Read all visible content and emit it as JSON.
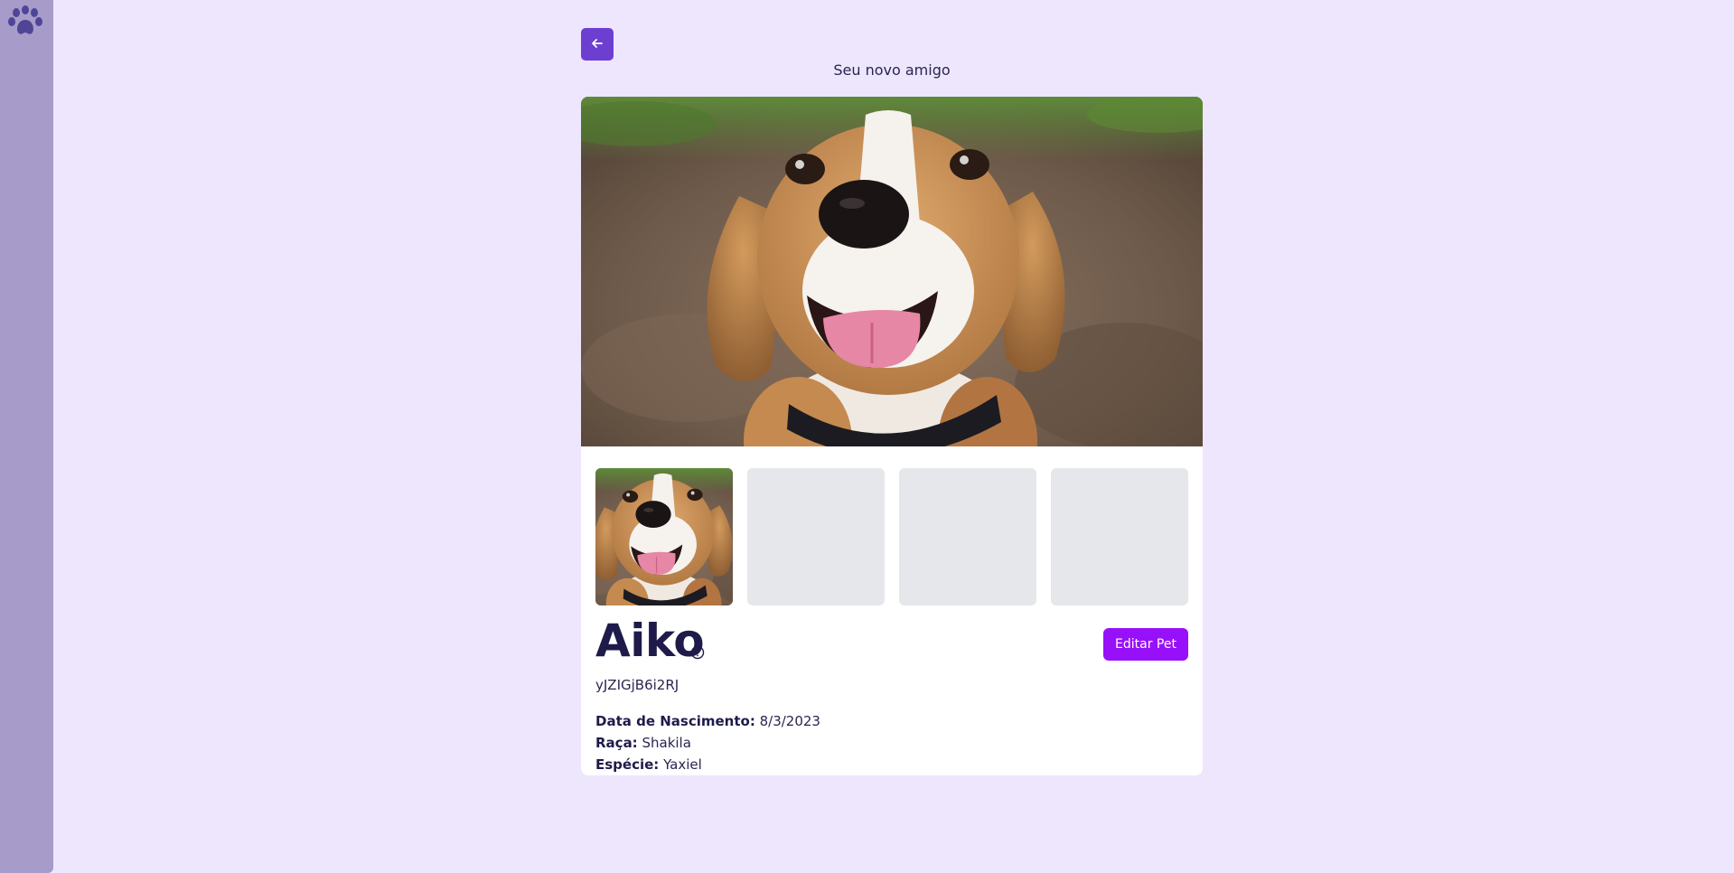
{
  "sidebar": {
    "logo_icon": "paw-icon"
  },
  "header": {
    "back_icon": "arrow-left-icon",
    "subtitle": "Seu novo amigo"
  },
  "gallery": {
    "main_image": "beagle-photo",
    "thumbnails": [
      {
        "kind": "beagle-photo",
        "selected": true
      },
      {
        "kind": "placeholder"
      },
      {
        "kind": "placeholder"
      },
      {
        "kind": "placeholder"
      }
    ]
  },
  "pet": {
    "name": "Aiko",
    "help_icon": "question-circle-icon",
    "code": "yJZIGjB6i2RJ",
    "edit_label": "Editar Pet",
    "details": [
      {
        "label": "Data de Nascimento:",
        "value": "8/3/2023"
      },
      {
        "label": "Raça:",
        "value": "Shakila"
      },
      {
        "label": "Espécie:",
        "value": "Yaxiel"
      }
    ]
  },
  "colors": {
    "background": "#ede6fd",
    "sidebar": "#a79bc9",
    "back_button": "#6d3fd1",
    "edit_button": "#9810fa",
    "text_dark": "#1e1b4b",
    "placeholder": "#e5e7eb"
  }
}
